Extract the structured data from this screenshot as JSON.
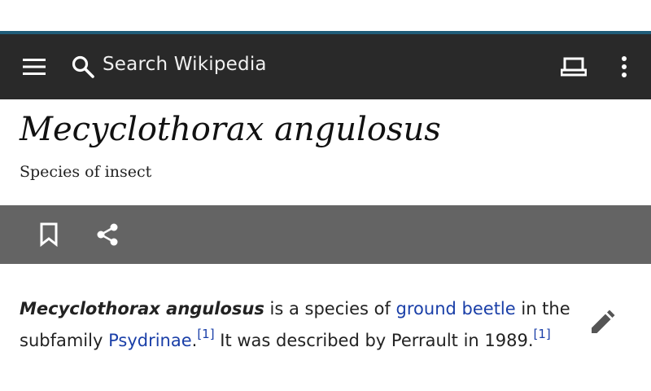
{
  "toolbar": {
    "search_placeholder": "Search Wikipedia",
    "icons": [
      "menu-icon",
      "search-icon",
      "reading-list-icon",
      "overflow-menu-icon"
    ]
  },
  "article": {
    "title": "Mecyclothorax angulosus",
    "description": "Species of insect",
    "actions": [
      "bookmark-icon",
      "share-icon"
    ],
    "edit_icon": "pencil-icon",
    "paragraph": {
      "subject": "Mecyclothorax angulosus",
      "text1": " is a species of ",
      "link1": "ground beetle",
      "text2": " in the subfamily ",
      "link2": "Psydrinae",
      "text3": ".",
      "ref1": "[1]",
      "text4": " It was described by Perrault in 1989.",
      "ref2": "[1]"
    }
  },
  "colors": {
    "toolbar_bg": "#292929",
    "action_bar_bg": "#646464",
    "link": "#1a3fa8"
  }
}
